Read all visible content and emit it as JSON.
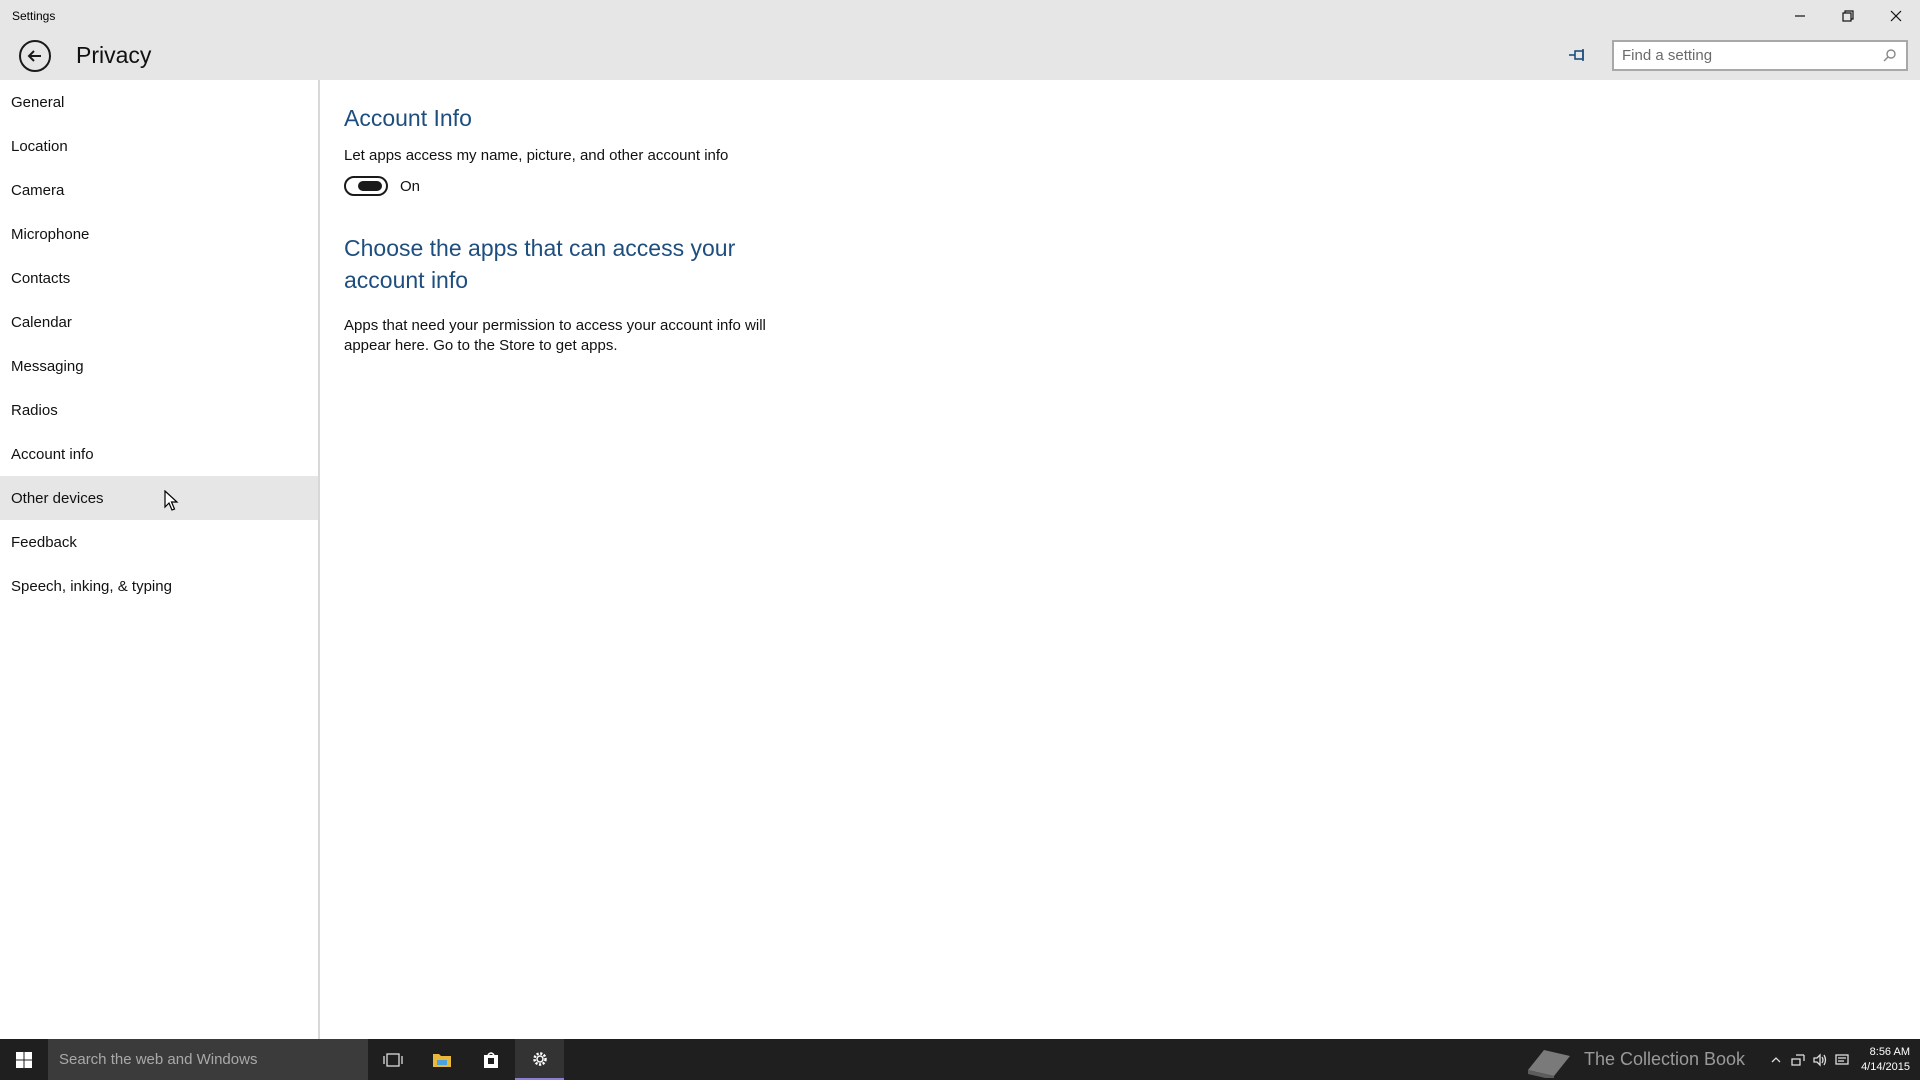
{
  "window": {
    "app_name": "Settings"
  },
  "header": {
    "title": "Privacy",
    "search_placeholder": "Find a setting"
  },
  "sidebar": {
    "items": [
      {
        "label": "General"
      },
      {
        "label": "Location"
      },
      {
        "label": "Camera"
      },
      {
        "label": "Microphone"
      },
      {
        "label": "Contacts"
      },
      {
        "label": "Calendar"
      },
      {
        "label": "Messaging"
      },
      {
        "label": "Radios"
      },
      {
        "label": "Account info"
      },
      {
        "label": "Other devices"
      },
      {
        "label": "Feedback"
      },
      {
        "label": "Speech, inking, & typing"
      }
    ],
    "hovered_item": "Other devices"
  },
  "content": {
    "section_title": "Account Info",
    "setting_desc": "Let apps access my name, picture, and other account info",
    "toggle_state": "On",
    "choose_title": "Choose the apps that can access your account info",
    "choose_body": "Apps that need your permission to access your account info will appear here. Go to the Store to get apps."
  },
  "taskbar": {
    "search_text": "Search the web and Windows",
    "watermark": "The Collection Book",
    "time": "8:56 AM",
    "date": "4/14/2015"
  },
  "colors": {
    "accent": "#1e4e7e",
    "titlebar_bg": "#e6e6e6",
    "taskbar_bg": "#1f1f1f",
    "active_task_indicator": "#8b7fd4"
  }
}
